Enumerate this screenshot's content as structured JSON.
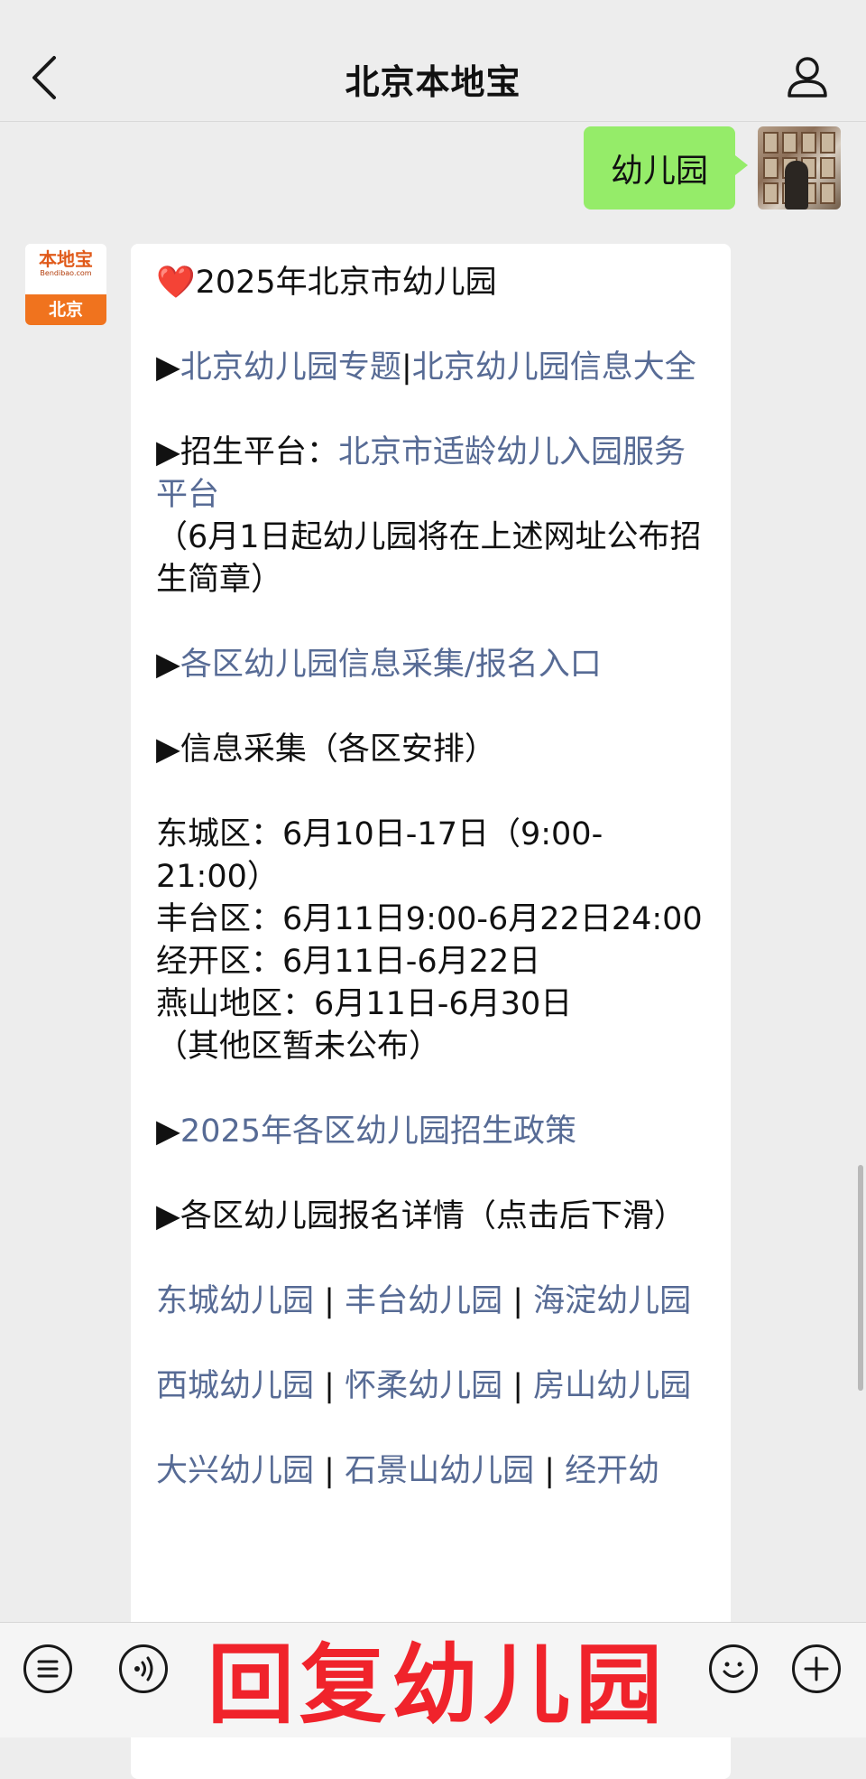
{
  "header": {
    "title": "北京本地宝"
  },
  "user_message": {
    "text": "幼儿园"
  },
  "bot_avatar": {
    "logo_cn": "本地宝",
    "logo_en": "Bendibao.com",
    "city": "北京"
  },
  "bot_message": {
    "heart": "❤️",
    "title": "2025年北京市幼儿园",
    "arrow": "▶",
    "line1_link_a": "北京幼儿园专题",
    "line1_sep": "|",
    "line1_link_b": "北京幼儿园信息大全",
    "line2_label": "招生平台：",
    "line2_link": "北京市适龄幼儿入园服务平台",
    "line2_note": "（6月1日起幼儿园将在上述网址公布招生简章）",
    "line3_link": "各区幼儿园信息采集/报名入口",
    "line4_text": "信息采集（各区安排）",
    "schedule": [
      "东城区：6月10日-17日（9:00-21:00）",
      "丰台区：6月11日9:00-6月22日24:00",
      "经开区：6月11日-6月22日",
      "燕山地区：6月11日-6月30日",
      "（其他区暂未公布）"
    ],
    "line5_link": "2025年各区幼儿园招生政策",
    "line6_text": "各区幼儿园报名详情（点击后下滑）",
    "districts": [
      [
        "东城幼儿园",
        "丰台幼儿园",
        "海淀幼儿园"
      ],
      [
        "西城幼儿园",
        "怀柔幼儿园",
        "房山幼儿园"
      ],
      [
        "大兴幼儿园",
        "石景山幼儿园",
        "经开幼"
      ]
    ],
    "district_sep": " | "
  },
  "input_bar": {
    "overlay_text": "回复幼儿园"
  },
  "icons": [
    "back-chevron-icon",
    "person-icon",
    "menu-list-icon",
    "voice-icon",
    "emoji-icon",
    "plus-icon"
  ],
  "colors": {
    "link": "#576b95",
    "user_bubble": "#95ec69",
    "overlay_text": "#f0232b"
  }
}
